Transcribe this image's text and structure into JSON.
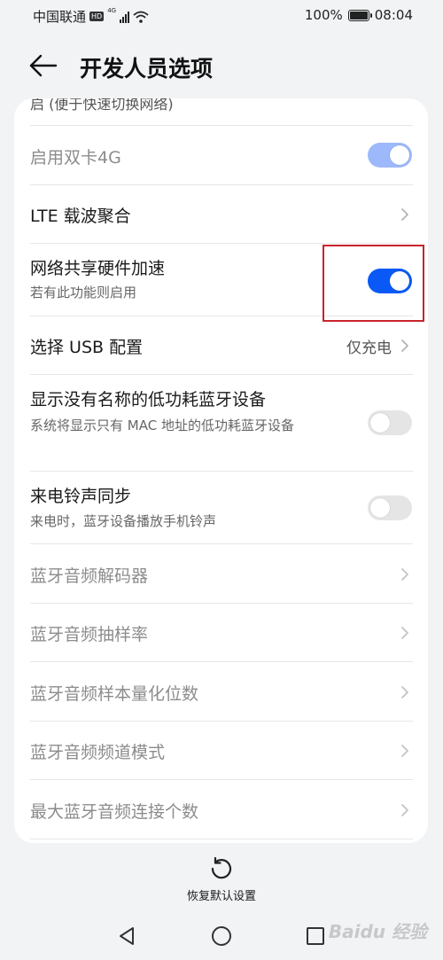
{
  "status_bar": {
    "carrier": "中国联通",
    "hd": "HD",
    "network": "4G",
    "battery": "100%",
    "time": "08:04"
  },
  "header": {
    "title": "开发人员选项"
  },
  "settings": {
    "partial_top_text": "启 (便于快速切换网络)",
    "dual_sim_4g": {
      "title": "启用双卡4G",
      "enabled": true,
      "disabled": true
    },
    "lte_ca": {
      "title": "LTE 载波聚合"
    },
    "tethering_hw_accel": {
      "title": "网络共享硬件加速",
      "subtitle": "若有此功能则启用",
      "enabled": true
    },
    "usb_config": {
      "title": "选择 USB 配置",
      "value": "仅充电"
    },
    "show_unnamed_ble": {
      "title": "显示没有名称的低功耗蓝牙设备",
      "subtitle": "系统将显示只有 MAC 地址的低功耗蓝牙设备",
      "enabled": false
    },
    "ringtone_sync": {
      "title": "来电铃声同步",
      "subtitle": "来电时，蓝牙设备播放手机铃声",
      "enabled": false
    },
    "bt_codec": {
      "title": "蓝牙音频解码器"
    },
    "bt_sample_rate": {
      "title": "蓝牙音频抽样率"
    },
    "bt_bits_per_sample": {
      "title": "蓝牙音频样本量化位数"
    },
    "bt_channel_mode": {
      "title": "蓝牙音频频道模式"
    },
    "bt_max_devices": {
      "title": "最大蓝牙音频连接个数"
    }
  },
  "footer": {
    "reset_label": "恢复默认设置"
  },
  "watermark": "Baidu 经验",
  "colors": {
    "accent": "#0a59f7",
    "toggle_disabled_on": "#9db9fb",
    "toggle_off": "#e5e5e5",
    "highlight_box": "#c8232c",
    "background": "#f1f3f5"
  }
}
